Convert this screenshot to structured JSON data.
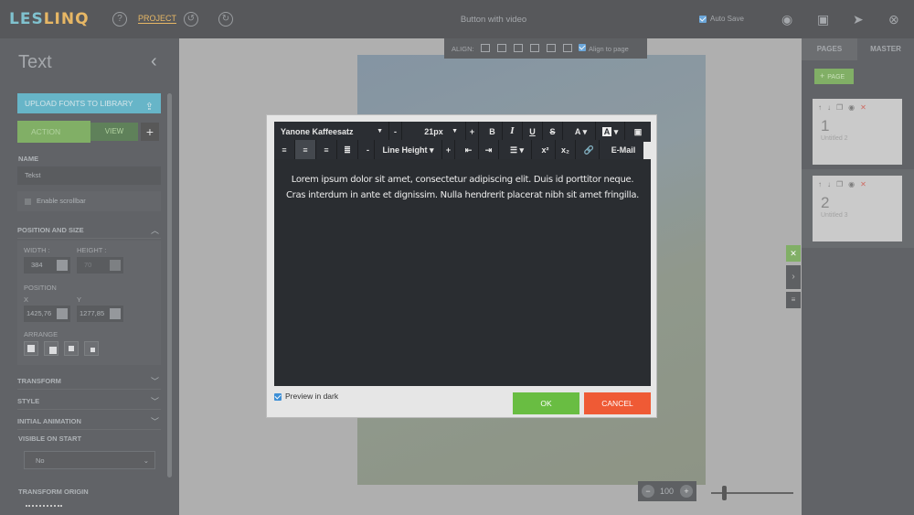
{
  "topbar": {
    "logo_a": "LES",
    "logo_b": "LINQ",
    "project": "PROJECT",
    "title": "Button with video",
    "autosave": "Auto Save"
  },
  "left": {
    "title": "Text",
    "upload": "UPLOAD FONTS TO LIBRARY",
    "action": "ACTION",
    "view": "VIEW",
    "name_label": "NAME",
    "name_value": "Tekst",
    "enable_scrollbar": "Enable scrollbar",
    "pos_size": "POSITION AND SIZE",
    "width_label": "WIDTH :",
    "height_label": "HEIGHT :",
    "width_value": "384",
    "height_value": "70",
    "position": "POSITION",
    "x_label": "X",
    "y_label": "Y",
    "x_value": "1425,76",
    "y_value": "1277,85",
    "arrange": "ARRANGE",
    "transform": "TRANSFORM",
    "style": "STYLE",
    "initial_animation": "INITIAL ANIMATION",
    "visible_on_start": "VISIBLE ON START",
    "visible_value": "No",
    "transform_origin": "TRANSFORM ORIGIN"
  },
  "canvas": {
    "align": "ALIGN:",
    "align_to_page": "Align to page",
    "zoom": "100"
  },
  "right": {
    "tab_pages": "PAGES",
    "tab_master": "MASTER",
    "add_page": "PAGE",
    "pages": [
      {
        "num": "1",
        "name": "Untitled 2"
      },
      {
        "num": "2",
        "name": "Untitled 3"
      }
    ]
  },
  "modal": {
    "font": "Yanone Kaffeesatz",
    "size": "21px",
    "line_height": "Line Height",
    "email": "E-Mail",
    "text": "Lorem ipsum dolor sit amet, consectetur adipiscing elit. Duis id porttitor neque. Cras interdum in ante et dignissim. Nulla hendrerit placerat nibh sit amet fringilla.",
    "preview": "Preview in dark",
    "ok": "OK",
    "cancel": "CANCEL"
  },
  "colors": {
    "accent_green": "#69bd42",
    "accent_orange": "#ef5a35",
    "accent_blue": "#37a3bd",
    "logo_gold": "#e8a634"
  }
}
